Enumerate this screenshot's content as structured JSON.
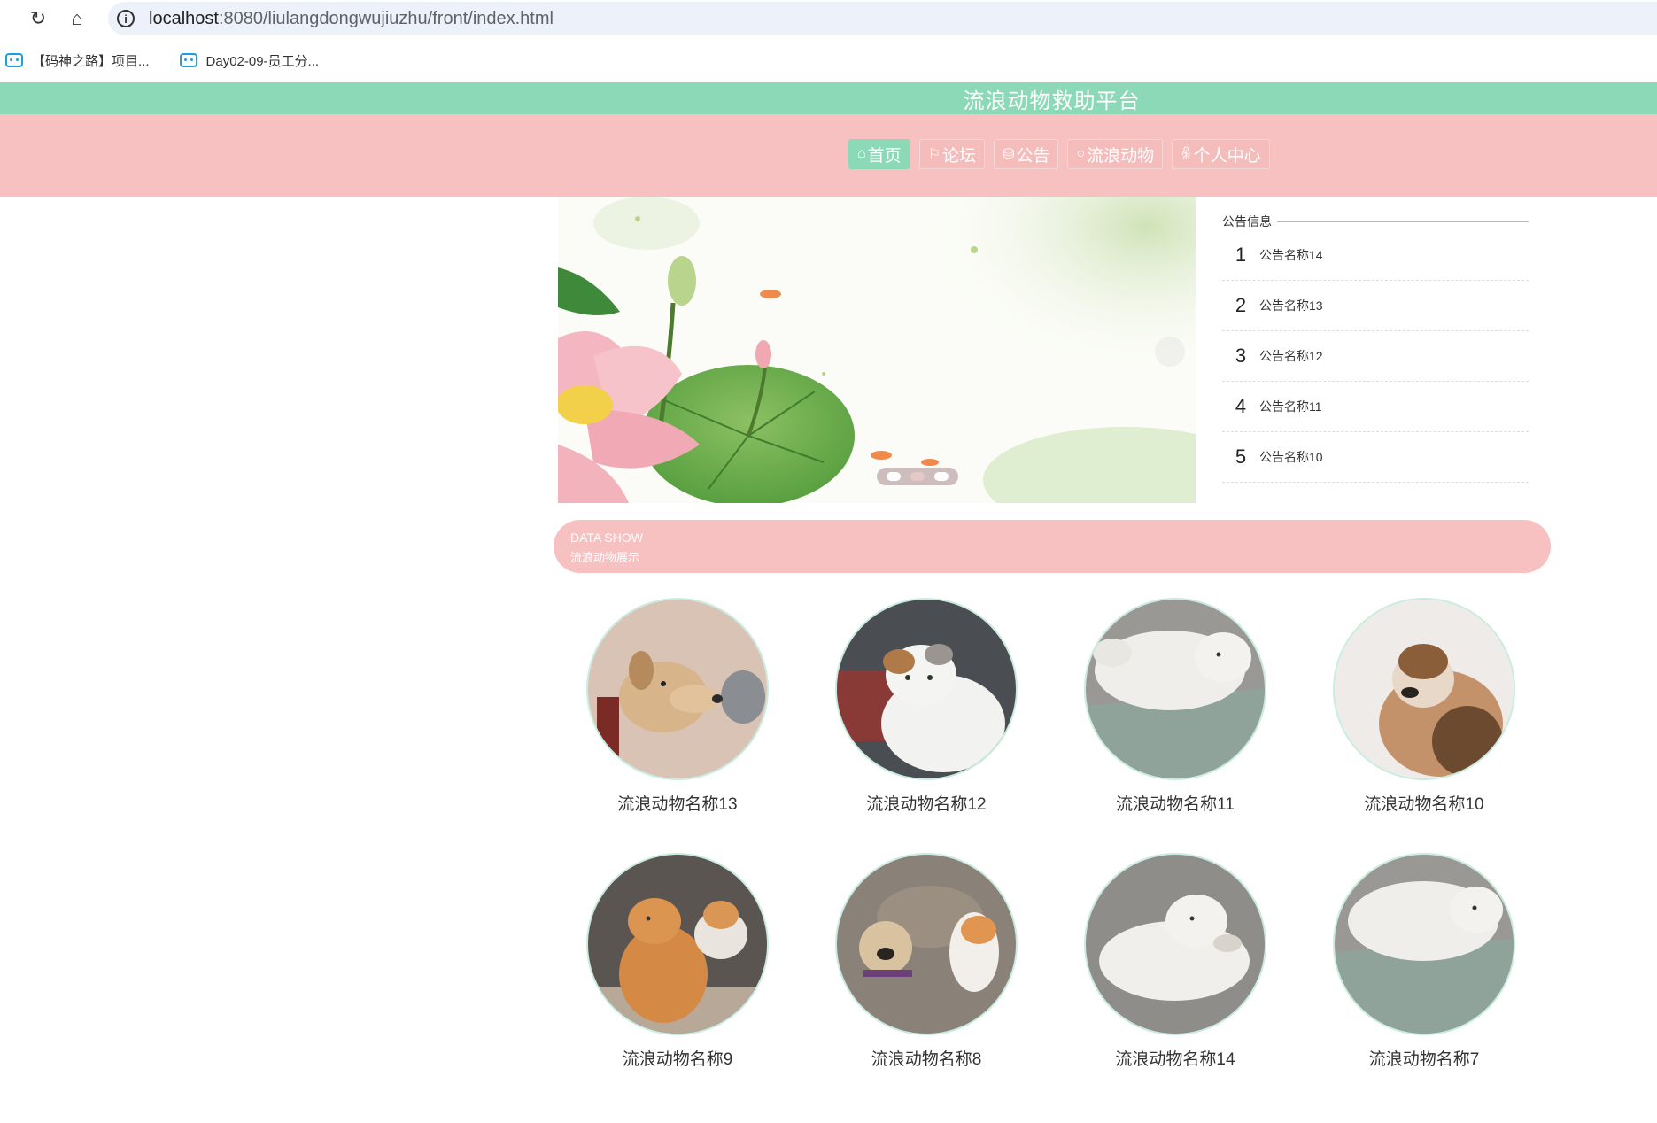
{
  "browser": {
    "url_host": "localhost",
    "url_rest": ":8080/liulangdongwujiuzhu/front/index.html",
    "bookmarks": [
      {
        "label": "【码神之路】项目..."
      },
      {
        "label": "Day02-09-员工分..."
      }
    ]
  },
  "site": {
    "title": "流浪动物救助平台",
    "nav": [
      {
        "icon": "⌂",
        "label": "首页",
        "active": true
      },
      {
        "icon": "⚐",
        "label": "论坛"
      },
      {
        "icon": "⛁",
        "label": "公告"
      },
      {
        "icon": "○",
        "label": "流浪动物"
      },
      {
        "icon": "ꆜ",
        "label": "个人中心"
      }
    ]
  },
  "notice": {
    "heading": "公告信息",
    "items": [
      {
        "num": "1",
        "title": "公告名称14"
      },
      {
        "num": "2",
        "title": "公告名称13"
      },
      {
        "num": "3",
        "title": "公告名称12"
      },
      {
        "num": "4",
        "title": "公告名称11"
      },
      {
        "num": "5",
        "title": "公告名称10"
      }
    ]
  },
  "data_show": {
    "en": "DATA SHOW",
    "cn": "流浪动物展示"
  },
  "animals": [
    {
      "name": "流浪动物名称13"
    },
    {
      "name": "流浪动物名称12"
    },
    {
      "name": "流浪动物名称11"
    },
    {
      "name": "流浪动物名称10"
    },
    {
      "name": "流浪动物名称9"
    },
    {
      "name": "流浪动物名称8"
    },
    {
      "name": "流浪动物名称14"
    },
    {
      "name": "流浪动物名称7"
    }
  ],
  "colors": {
    "title_bar": "#8cd9b8",
    "nav_bar": "#f7c1c2",
    "active_nav": "#8cd9b8"
  }
}
